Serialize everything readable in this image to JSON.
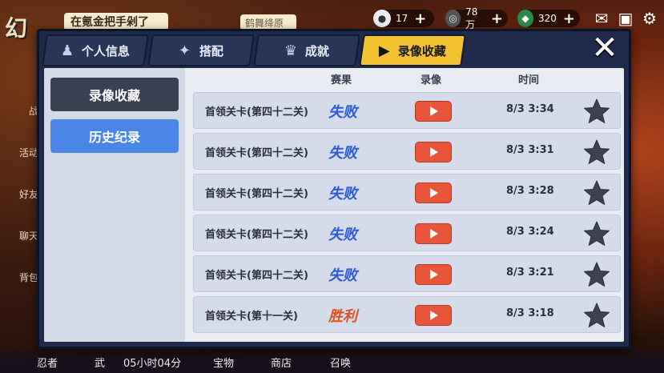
{
  "hud": {
    "logo": "幻",
    "banner": "在氪金把手剁了",
    "banner2": "鹤舞绛原",
    "resources": [
      {
        "icon": "rice-ball-icon",
        "value": "17"
      },
      {
        "icon": "coin-icon",
        "value": "78万"
      },
      {
        "icon": "jade-icon",
        "value": "320"
      }
    ]
  },
  "side_hud": [
    "战",
    "活动",
    "好友",
    "聊天",
    "背包"
  ],
  "bottom_bar": {
    "ninja": "忍者",
    "weapon": "武",
    "timer": "05小时04分",
    "treasure": "宝物",
    "shop": "商店",
    "summon": "召唤"
  },
  "tabs": [
    {
      "label": "个人信息",
      "icon": "profile-icon"
    },
    {
      "label": "搭配",
      "icon": "shuriken-icon"
    },
    {
      "label": "成就",
      "icon": "trophy-icon"
    },
    {
      "label": "录像收藏",
      "icon": "play-icon",
      "active": true
    }
  ],
  "close_label": "✕",
  "sidebar": {
    "items": [
      {
        "label": "录像收藏",
        "style": "dark"
      },
      {
        "label": "历史纪录",
        "style": "blue"
      }
    ]
  },
  "columns": {
    "match": "赛果",
    "replay": "录像",
    "time": "时间"
  },
  "records": [
    {
      "stage": "首领关卡(第四十二关)",
      "result": "失败",
      "outcome": "lose",
      "time": "8/3 3:34"
    },
    {
      "stage": "首领关卡(第四十二关)",
      "result": "失败",
      "outcome": "lose",
      "time": "8/3 3:31"
    },
    {
      "stage": "首领关卡(第四十二关)",
      "result": "失败",
      "outcome": "lose",
      "time": "8/3 3:28"
    },
    {
      "stage": "首领关卡(第四十二关)",
      "result": "失败",
      "outcome": "lose",
      "time": "8/3 3:24"
    },
    {
      "stage": "首领关卡(第四十二关)",
      "result": "失败",
      "outcome": "lose",
      "time": "8/3 3:21"
    },
    {
      "stage": "首领关卡(第十一关)",
      "result": "胜利",
      "outcome": "win",
      "time": "8/3 3:18"
    }
  ],
  "colors": {
    "active_tab": "#f2c230",
    "play_button": "#e8553a",
    "lose": "#2c5ad6",
    "win": "#e0501e"
  }
}
